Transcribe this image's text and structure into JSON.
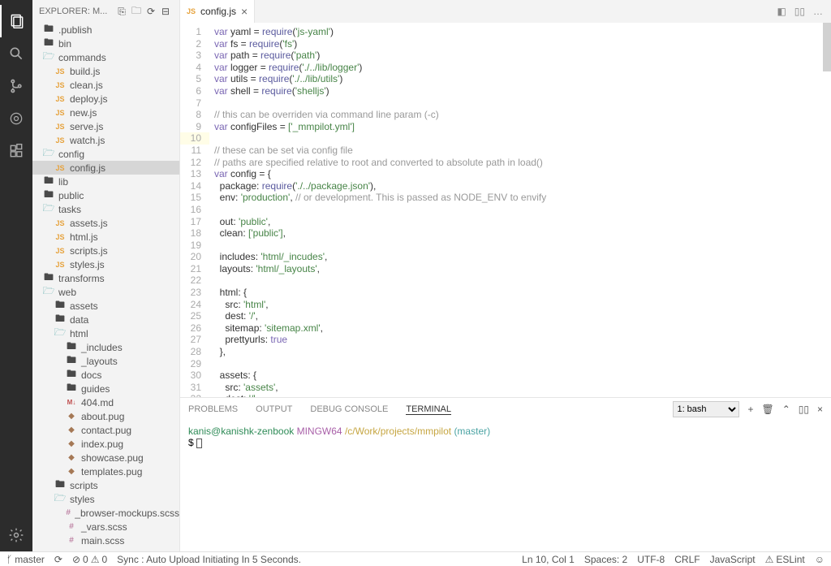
{
  "sidebar": {
    "title": "EXPLORER: M...",
    "items": [
      {
        "label": ".publish",
        "type": "folder",
        "depth": 0
      },
      {
        "label": "bin",
        "type": "folder",
        "depth": 0
      },
      {
        "label": "commands",
        "type": "folder-open",
        "depth": 0
      },
      {
        "label": "build.js",
        "type": "js",
        "depth": 1
      },
      {
        "label": "clean.js",
        "type": "js",
        "depth": 1
      },
      {
        "label": "deploy.js",
        "type": "js",
        "depth": 1
      },
      {
        "label": "new.js",
        "type": "js",
        "depth": 1
      },
      {
        "label": "serve.js",
        "type": "js",
        "depth": 1
      },
      {
        "label": "watch.js",
        "type": "js",
        "depth": 1
      },
      {
        "label": "config",
        "type": "folder-open",
        "depth": 0
      },
      {
        "label": "config.js",
        "type": "js",
        "depth": 1,
        "selected": true
      },
      {
        "label": "lib",
        "type": "folder",
        "depth": 0
      },
      {
        "label": "public",
        "type": "folder",
        "depth": 0
      },
      {
        "label": "tasks",
        "type": "folder-open",
        "depth": 0
      },
      {
        "label": "assets.js",
        "type": "js",
        "depth": 1
      },
      {
        "label": "html.js",
        "type": "js",
        "depth": 1
      },
      {
        "label": "scripts.js",
        "type": "js",
        "depth": 1
      },
      {
        "label": "styles.js",
        "type": "js",
        "depth": 1
      },
      {
        "label": "transforms",
        "type": "folder",
        "depth": 0
      },
      {
        "label": "web",
        "type": "folder-open",
        "depth": 0
      },
      {
        "label": "assets",
        "type": "folder",
        "depth": 1
      },
      {
        "label": "data",
        "type": "folder",
        "depth": 1
      },
      {
        "label": "html",
        "type": "folder-open",
        "depth": 1
      },
      {
        "label": "_includes",
        "type": "folder",
        "depth": 2
      },
      {
        "label": "_layouts",
        "type": "folder",
        "depth": 2
      },
      {
        "label": "docs",
        "type": "folder",
        "depth": 2
      },
      {
        "label": "guides",
        "type": "folder",
        "depth": 2
      },
      {
        "label": "404.md",
        "type": "md",
        "depth": 2
      },
      {
        "label": "about.pug",
        "type": "pug",
        "depth": 2
      },
      {
        "label": "contact.pug",
        "type": "pug",
        "depth": 2
      },
      {
        "label": "index.pug",
        "type": "pug",
        "depth": 2
      },
      {
        "label": "showcase.pug",
        "type": "pug",
        "depth": 2
      },
      {
        "label": "templates.pug",
        "type": "pug",
        "depth": 2
      },
      {
        "label": "scripts",
        "type": "folder",
        "depth": 1
      },
      {
        "label": "styles",
        "type": "folder-open",
        "depth": 1
      },
      {
        "label": "_browser-mockups.scss",
        "type": "scss",
        "depth": 2
      },
      {
        "label": "_vars.scss",
        "type": "scss",
        "depth": 2
      },
      {
        "label": "main.scss",
        "type": "scss",
        "depth": 2
      }
    ]
  },
  "tab": {
    "label": "config.js"
  },
  "panel": {
    "tabs": [
      "PROBLEMS",
      "OUTPUT",
      "DEBUG CONSOLE",
      "TERMINAL"
    ],
    "active": 3,
    "terminal_select": "1: bash",
    "term_user": "kanis@kanishk-zenbook",
    "term_sys": "MINGW64",
    "term_path": "/c/Work/projects/mmpilot",
    "term_branch": "(master)",
    "prompt": "$"
  },
  "status": {
    "branch": "master",
    "sync": "",
    "errors": "0",
    "warnings": "0",
    "sync_msg": "Sync : Auto Upload Initiating In 5 Seconds.",
    "line_col": "Ln 10, Col 1",
    "spaces": "Spaces: 2",
    "encoding": "UTF-8",
    "eol": "CRLF",
    "language": "JavaScript",
    "eslint": "ESLint"
  },
  "code": {
    "lines": [
      {
        "t": "var",
        "n": "yaml",
        "r": "'js-yaml'"
      },
      {
        "t": "var",
        "n": "fs",
        "r": "'fs'"
      },
      {
        "t": "var",
        "n": "path",
        "r": "'path'"
      },
      {
        "t": "var",
        "n": "logger",
        "r": "'./../lib/logger'"
      },
      {
        "t": "var",
        "n": "utils",
        "r": "'./../lib/utils'"
      },
      {
        "t": "var",
        "n": "shell",
        "r": "'shelljs'"
      }
    ],
    "comment1": "// this can be overriden via command line param (-c)",
    "config_files": "['_mmpilot.yml']",
    "comment2": "// these can be set via config file",
    "comment3": "// paths are specified relative to root and converted to absolute path in load()",
    "package_path": "'./../package.json'",
    "env": "'production'",
    "env_comment": "// or development. This is passed as NODE_ENV to envify",
    "out": "'public'",
    "clean": "['public']",
    "includes": "'html/_incudes'",
    "layouts": "'html/_layouts'",
    "html_src": "'html'",
    "html_dest": "'/'",
    "sitemap": "'sitemap.xml'",
    "prettyurls": "true",
    "assets_src": "'assets'",
    "assets_dest": "'/'"
  }
}
